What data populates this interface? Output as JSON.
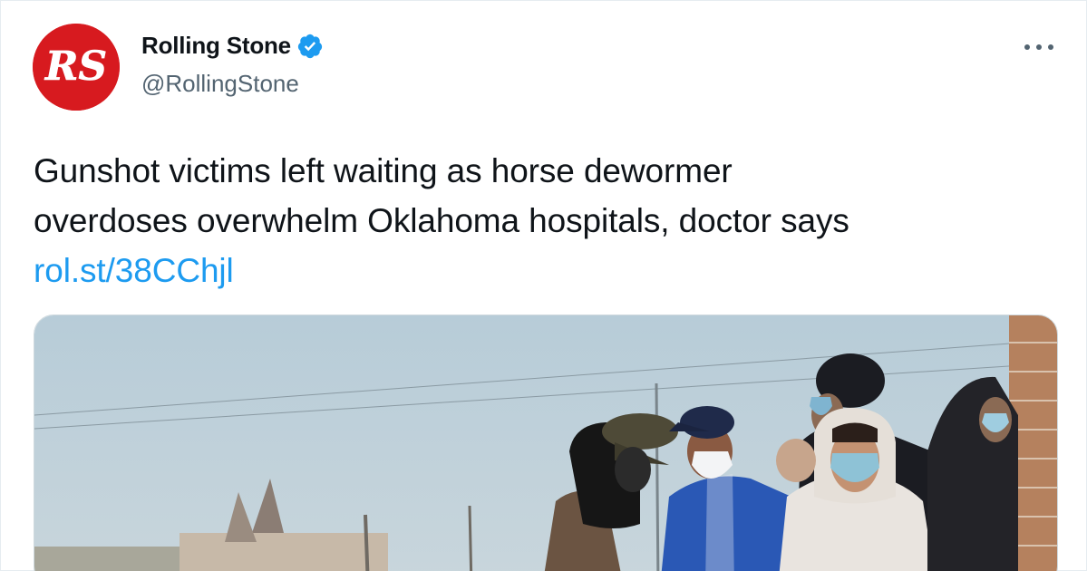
{
  "author": {
    "display_name": "Rolling Stone",
    "handle": "@RollingStone",
    "verified": true,
    "avatar_icon": "rolling-stone-logo-icon",
    "avatar_text": "RS",
    "avatar_color": "#d71a1f"
  },
  "menu": {
    "icon": "more-horizontal-icon"
  },
  "tweet": {
    "text_line_1": "Gunshot victims left waiting as horse dewormer",
    "text_line_2": "overdoses overwhelm Oklahoma hospitals, doctor says",
    "link": "rol.st/38CChjl"
  },
  "media": {
    "type": "photo",
    "description_icon": "news-photo-image"
  },
  "colors": {
    "accent": "#1d9bf0",
    "text": "#0f1419",
    "secondary_text": "#536471",
    "brand": "#d71a1f"
  }
}
